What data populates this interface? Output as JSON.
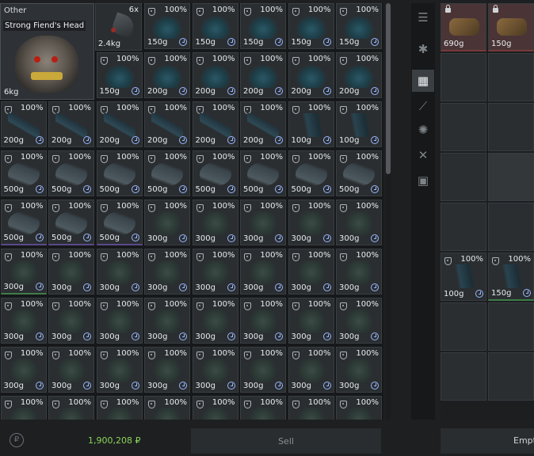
{
  "inventory": {
    "featured": {
      "category": "Other",
      "name": "Strong Fiend's Head",
      "weight": "6kg"
    },
    "horn": {
      "count": "6x",
      "weight": "2.4kg"
    },
    "rows": [
      [
        {
          "pct": "100%",
          "wt": "150g",
          "art": "feather"
        },
        {
          "pct": "100%",
          "wt": "150g",
          "art": "feather"
        },
        {
          "pct": "100%",
          "wt": "150g",
          "art": "feather"
        },
        {
          "pct": "100%",
          "wt": "150g",
          "art": "feather"
        },
        {
          "pct": "100%",
          "wt": "150g",
          "art": "feather"
        }
      ],
      [
        {
          "pct": "100%",
          "wt": "150g",
          "art": "feather"
        },
        {
          "pct": "100%",
          "wt": "200g",
          "art": "feather"
        },
        {
          "pct": "100%",
          "wt": "200g",
          "art": "feather"
        },
        {
          "pct": "100%",
          "wt": "200g",
          "art": "feather"
        },
        {
          "pct": "100%",
          "wt": "200g",
          "art": "feather"
        },
        {
          "pct": "100%",
          "wt": "200g",
          "art": "feather"
        }
      ],
      [
        {
          "pct": "100%",
          "wt": "200g",
          "art": "blade"
        },
        {
          "pct": "100%",
          "wt": "200g",
          "art": "blade"
        },
        {
          "pct": "100%",
          "wt": "200g",
          "art": "blade"
        },
        {
          "pct": "100%",
          "wt": "200g",
          "art": "blade"
        },
        {
          "pct": "100%",
          "wt": "200g",
          "art": "blade"
        },
        {
          "pct": "100%",
          "wt": "200g",
          "art": "blade"
        },
        {
          "pct": "100%",
          "wt": "100g",
          "art": "shard"
        },
        {
          "pct": "100%",
          "wt": "100g",
          "art": "shard"
        }
      ],
      [
        {
          "pct": "100%",
          "wt": "500g",
          "art": "tail"
        },
        {
          "pct": "100%",
          "wt": "500g",
          "art": "tail"
        },
        {
          "pct": "100%",
          "wt": "500g",
          "art": "tail"
        },
        {
          "pct": "100%",
          "wt": "500g",
          "art": "tail"
        },
        {
          "pct": "100%",
          "wt": "500g",
          "art": "tail"
        },
        {
          "pct": "100%",
          "wt": "500g",
          "art": "tail"
        },
        {
          "pct": "100%",
          "wt": "500g",
          "art": "tail"
        },
        {
          "pct": "100%",
          "wt": "500g",
          "art": "tail"
        }
      ],
      [
        {
          "pct": "100%",
          "wt": "500g",
          "art": "tail"
        },
        {
          "pct": "100%",
          "wt": "500g",
          "art": "tail"
        },
        {
          "pct": "100%",
          "wt": "500g",
          "art": "tail"
        },
        {
          "pct": "100%",
          "wt": "300g",
          "art": "mesh"
        },
        {
          "pct": "100%",
          "wt": "300g",
          "art": "mesh"
        },
        {
          "pct": "100%",
          "wt": "300g",
          "art": "mesh"
        },
        {
          "pct": "100%",
          "wt": "300g",
          "art": "mesh"
        },
        {
          "pct": "100%",
          "wt": "300g",
          "art": "mesh"
        }
      ],
      [
        {
          "pct": "100%",
          "wt": "300g",
          "art": "mesh"
        },
        {
          "pct": "100%",
          "wt": "300g",
          "art": "mesh"
        },
        {
          "pct": "100%",
          "wt": "300g",
          "art": "mesh"
        },
        {
          "pct": "100%",
          "wt": "300g",
          "art": "mesh"
        },
        {
          "pct": "100%",
          "wt": "300g",
          "art": "mesh"
        },
        {
          "pct": "100%",
          "wt": "300g",
          "art": "mesh"
        },
        {
          "pct": "100%",
          "wt": "300g",
          "art": "mesh"
        },
        {
          "pct": "100%",
          "wt": "300g",
          "art": "mesh"
        }
      ],
      [
        {
          "pct": "100%",
          "wt": "300g",
          "art": "mesh"
        },
        {
          "pct": "100%",
          "wt": "300g",
          "art": "mesh"
        },
        {
          "pct": "100%",
          "wt": "300g",
          "art": "mesh"
        },
        {
          "pct": "100%",
          "wt": "300g",
          "art": "mesh"
        },
        {
          "pct": "100%",
          "wt": "300g",
          "art": "mesh"
        },
        {
          "pct": "100%",
          "wt": "300g",
          "art": "mesh"
        },
        {
          "pct": "100%",
          "wt": "300g",
          "art": "mesh"
        },
        {
          "pct": "100%",
          "wt": "300g",
          "art": "mesh"
        }
      ],
      [
        {
          "pct": "100%",
          "wt": "300g",
          "art": "mesh"
        },
        {
          "pct": "100%",
          "wt": "300g",
          "art": "mesh"
        },
        {
          "pct": "100%",
          "wt": "300g",
          "art": "mesh"
        },
        {
          "pct": "100%",
          "wt": "300g",
          "art": "mesh"
        },
        {
          "pct": "100%",
          "wt": "300g",
          "art": "mesh"
        },
        {
          "pct": "100%",
          "wt": "300g",
          "art": "mesh"
        },
        {
          "pct": "100%",
          "wt": "300g",
          "art": "mesh"
        },
        {
          "pct": "100%",
          "wt": "300g",
          "art": "mesh"
        }
      ],
      [
        {
          "pct": "100%",
          "wt": "",
          "art": "mesh"
        },
        {
          "pct": "100%",
          "wt": "",
          "art": "mesh"
        },
        {
          "pct": "100%",
          "wt": "",
          "art": "mesh"
        },
        {
          "pct": "100%",
          "wt": "",
          "art": "mesh"
        },
        {
          "pct": "100%",
          "wt": "",
          "art": "mesh"
        },
        {
          "pct": "100%",
          "wt": "",
          "art": "mesh"
        },
        {
          "pct": "100%",
          "wt": "",
          "art": "mesh"
        },
        {
          "pct": "100%",
          "wt": "",
          "art": "mesh"
        }
      ]
    ]
  },
  "sidebar": {
    "tabs": [
      {
        "icon": "list-icon",
        "glyph": "☰",
        "active": false
      },
      {
        "icon": "star-icon",
        "glyph": "✱",
        "active": false
      },
      {
        "icon": "grid-icon",
        "glyph": "▦",
        "active": true
      },
      {
        "icon": "blade-icon",
        "glyph": "⟋",
        "active": false
      },
      {
        "icon": "brain-icon",
        "glyph": "✺",
        "active": false
      },
      {
        "icon": "tools-icon",
        "glyph": "✕",
        "active": false
      },
      {
        "icon": "box-icon",
        "glyph": "▣",
        "active": false
      }
    ]
  },
  "stash": {
    "locked_items": [
      {
        "wt": "690g"
      },
      {
        "wt": "150g"
      }
    ],
    "items": [
      {
        "pct": "100%",
        "wt": "100g"
      },
      {
        "pct": "100%",
        "wt": "150g"
      }
    ]
  },
  "footer": {
    "money": "1,900,208 ₽",
    "sell_label": "Sell",
    "empty_label": "Empty"
  }
}
